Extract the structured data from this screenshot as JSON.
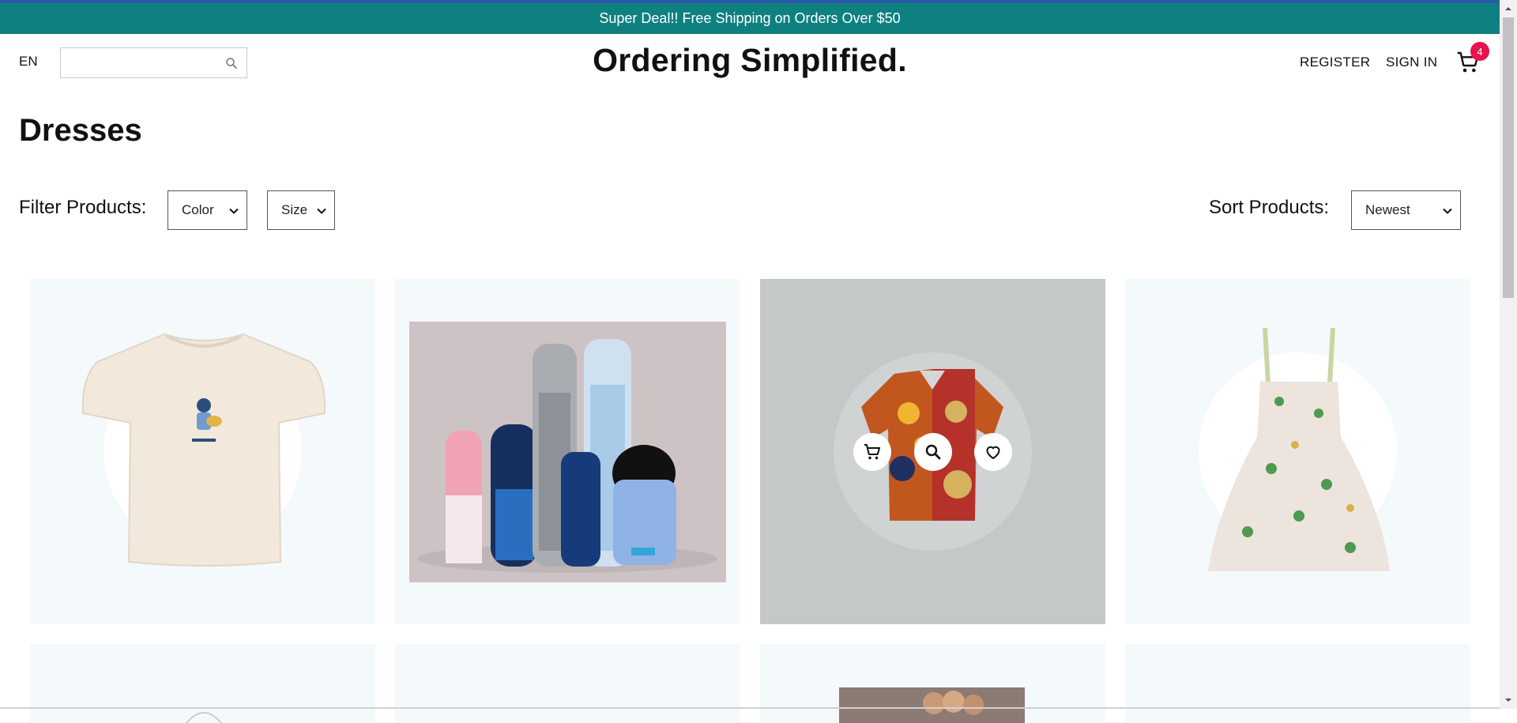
{
  "announcement": "Super Deal!! Free Shipping on Orders Over $50",
  "header": {
    "language": "EN",
    "search_value": "",
    "search_placeholder": "",
    "logo": "Ordering Simplified.",
    "register": "REGISTER",
    "sign_in": "SIGN IN",
    "cart_count": "4"
  },
  "page": {
    "title": "Dresses"
  },
  "filters": {
    "label": "Filter Products:",
    "color_selected": "Color",
    "size_selected": "Size",
    "sort_label": "Sort Products:",
    "sort_selected": "Newest"
  },
  "products": [
    {
      "name": "t-shirt",
      "hovered": false
    },
    {
      "name": "deodorants",
      "hovered": false
    },
    {
      "name": "hawaiian-shirt",
      "hovered": true
    },
    {
      "name": "floral-dress",
      "hovered": false
    }
  ],
  "colors": {
    "announcement_bg": "#0f8080",
    "badge": "#e8144f",
    "card_bg": "#f4f9fc"
  },
  "icons": [
    "search-icon",
    "cart-icon",
    "chevron-down-icon",
    "add-to-cart-icon",
    "zoom-icon",
    "heart-icon"
  ]
}
